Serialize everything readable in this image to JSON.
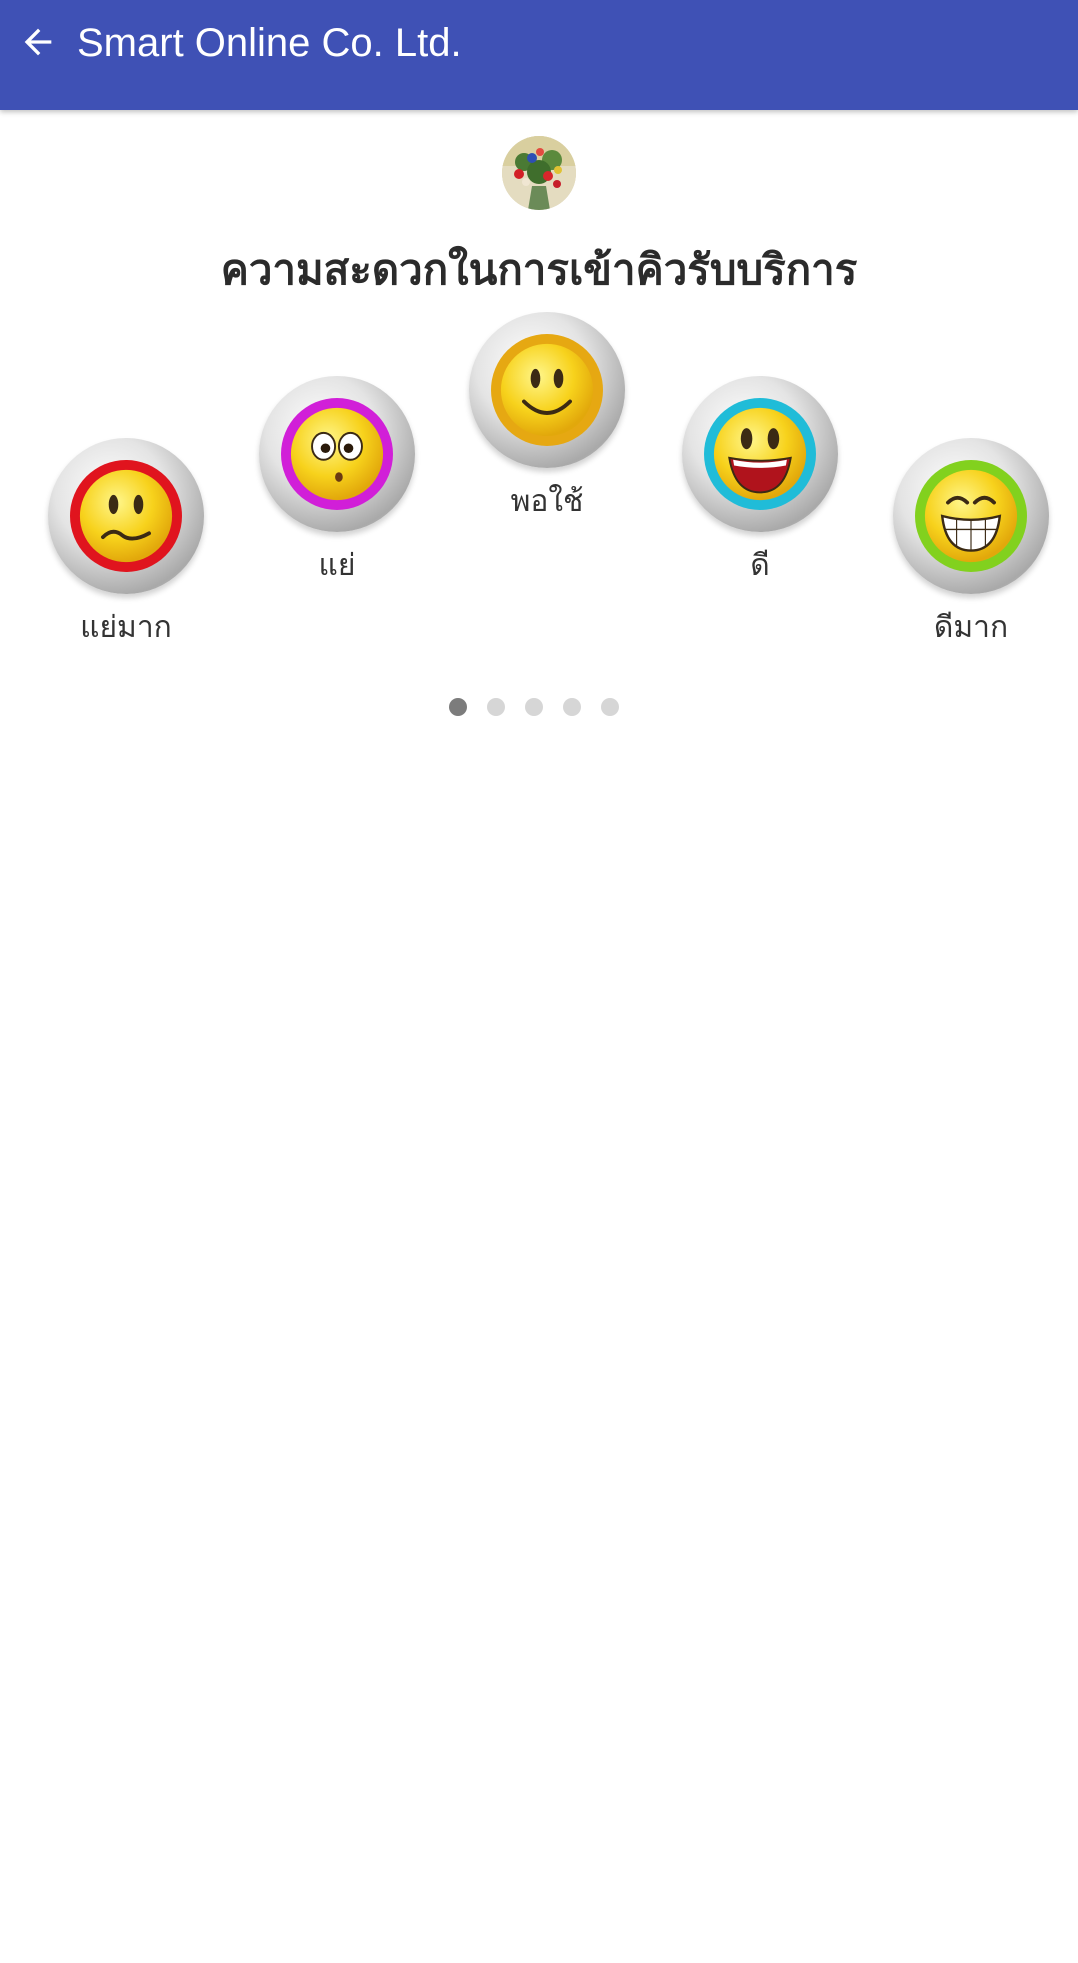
{
  "appbar": {
    "title": "Smart Online Co. Ltd.",
    "back_icon": "arrow-left-icon",
    "background": "#3f51b5"
  },
  "logo": {
    "icon": "flower-vase-photo"
  },
  "question": "ความสะดวกในการเข้าคิวรับบริการ",
  "ratings": [
    {
      "label": "แย่มาก",
      "icon": "sad-face-icon",
      "ring_color": "#e0141e"
    },
    {
      "label": "แย่",
      "icon": "surprised-face-icon",
      "ring_color": "#d11fd8"
    },
    {
      "label": "พอใช้",
      "icon": "smile-face-icon",
      "ring_color": "#e6a812"
    },
    {
      "label": "ดี",
      "icon": "happy-face-icon",
      "ring_color": "#20bcd8"
    },
    {
      "label": "ดีมาก",
      "icon": "grin-face-icon",
      "ring_color": "#82d11e"
    }
  ],
  "pager": {
    "count": 5,
    "active_index": 0
  }
}
